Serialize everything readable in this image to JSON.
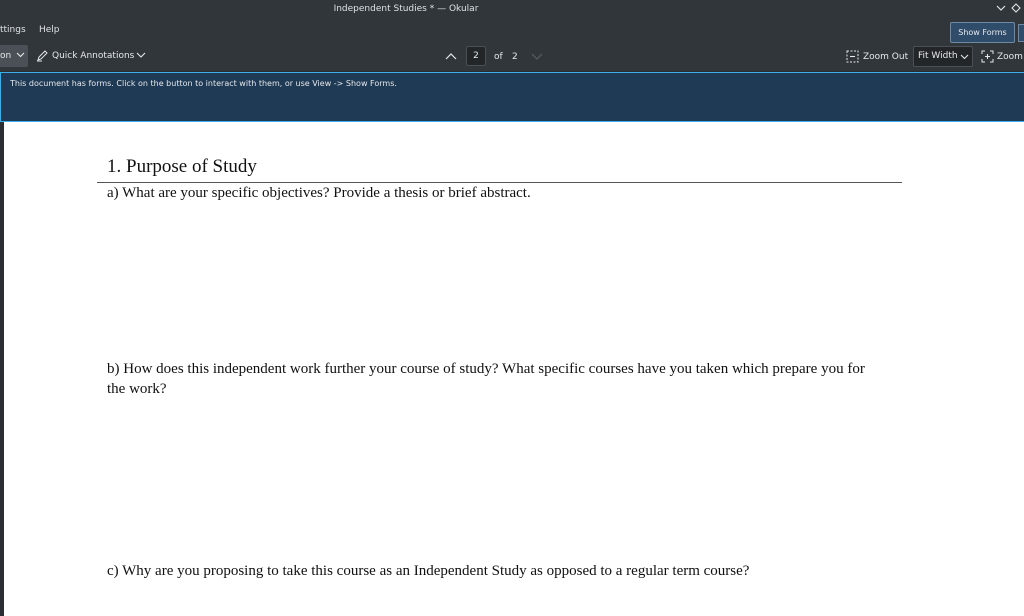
{
  "window": {
    "title": "Independent Studies * — Okular",
    "buttons": {
      "minimize_icon": "chevron-down-icon",
      "maximize_icon": "diamond-icon"
    }
  },
  "menubar": {
    "items": [
      {
        "label": "ttings"
      },
      {
        "label": "Help"
      }
    ]
  },
  "toolbar": {
    "mode_label": "on",
    "quick_annotations_label": "Quick Annotations",
    "page_current": "2",
    "page_of": "of",
    "page_total": "2",
    "zoom_out_label": "Zoom Out",
    "zoom_mode": "Fit Width",
    "zoom_in_label": "Zoom"
  },
  "infobar": {
    "message": "This document has forms. Click on the button to interact with them, or use View -> Show Forms.",
    "show_forms_label": "Show Forms"
  },
  "document": {
    "heading": "1. Purpose of Study",
    "question_a": "a) What are your specific objectives? Provide a thesis or brief abstract.",
    "question_b": "b) How does this independent work further your course of study? What specific courses have you taken which prepare you for the work?",
    "question_c": "c) Why are you proposing to take this course as an Independent Study as opposed to a regular term course?"
  },
  "colors": {
    "chrome_bg": "#31363b",
    "infobar_bg": "#1f3a55",
    "accent": "#3daee9",
    "page_bg": "#ffffff"
  }
}
